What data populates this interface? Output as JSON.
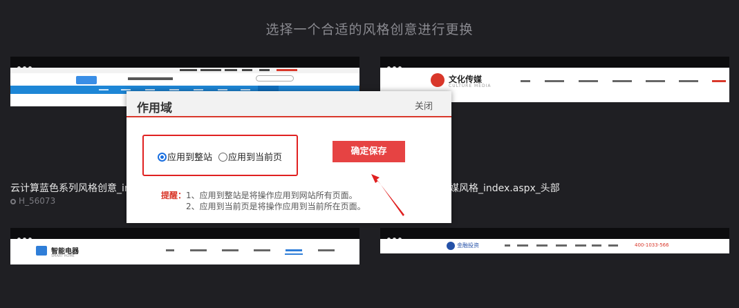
{
  "page": {
    "title": "选择一个合适的风格创意进行更换"
  },
  "cards": [
    {
      "caption": "云计算蓝色系列风格创意_in",
      "code": "H_56073"
    },
    {
      "caption": "媒风格_index.aspx_头部"
    },
    {
      "logo_text": "智能电器",
      "logo_sub": "SMART HOME"
    },
    {
      "logo_text": "金融投资",
      "phone": "400-1033-566"
    }
  ],
  "card2_thumb": {
    "logo_text": "文化传媒",
    "logo_sub": "CULTURE MEDIA"
  },
  "modal": {
    "title": "作用域",
    "close_label": "关闭",
    "radio_whole_site": "应用到整站",
    "radio_current_page": "应用到当前页",
    "selected": "whole_site",
    "save_label": "确定保存",
    "tips_label": "提醒：",
    "tips_line1": "1、应用到整站是将操作应用到网站所有页面。",
    "tips_line2": "2、应用到当前页是将操作应用到当前所在页面。"
  },
  "colors": {
    "background": "#1f1f23",
    "accent_red": "#e64343",
    "radio_blue": "#1a6fe0"
  }
}
